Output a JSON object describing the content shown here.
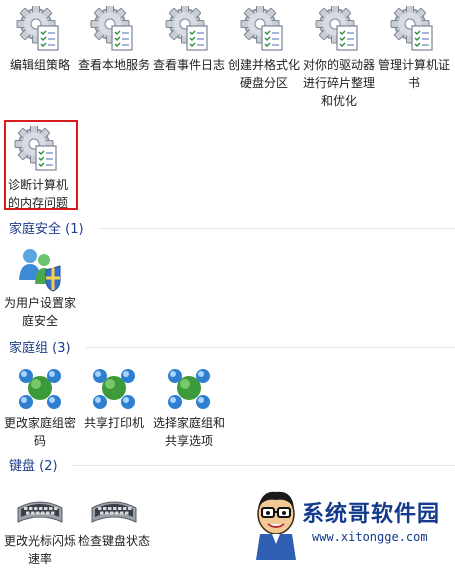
{
  "top_row": [
    {
      "label": "编辑组策略",
      "icon": "admin-tools-gear-icon"
    },
    {
      "label": "查看本地服务",
      "icon": "admin-tools-gear-icon"
    },
    {
      "label": "查看事件日志",
      "icon": "admin-tools-gear-icon"
    },
    {
      "label": "创建并格式化硬盘分区",
      "icon": "admin-tools-gear-icon"
    },
    {
      "label": "对你的驱动器进行碎片整理和优化",
      "icon": "admin-tools-gear-icon"
    },
    {
      "label": "管理计算机证书",
      "icon": "admin-tools-gear-icon"
    }
  ],
  "selected_item": {
    "label": "诊断计算机的内存问题",
    "icon": "admin-tools-gear-icon",
    "highlight_color": "#d91c1c"
  },
  "groups": [
    {
      "title": "家庭安全 (1)",
      "items": [
        {
          "label": "为用户设置家庭安全",
          "icon": "family-safety-icon"
        }
      ]
    },
    {
      "title": "家庭组 (3)",
      "items": [
        {
          "label": "更改家庭组密码",
          "icon": "homegroup-icon"
        },
        {
          "label": "共享打印机",
          "icon": "homegroup-icon"
        },
        {
          "label": "选择家庭组和共享选项",
          "icon": "homegroup-icon"
        }
      ]
    },
    {
      "title": "键盘 (2)",
      "items": [
        {
          "label": "更改光标闪烁速率",
          "icon": "keyboard-icon"
        },
        {
          "label": "检查键盘状态",
          "icon": "keyboard-icon"
        }
      ]
    }
  ],
  "watermark": {
    "title": "系统哥软件园",
    "url": "www.xitongge.com"
  },
  "colors": {
    "group_header": "#1e3b8a",
    "selection_border": "#d91c1c",
    "watermark": "#133a8c"
  }
}
